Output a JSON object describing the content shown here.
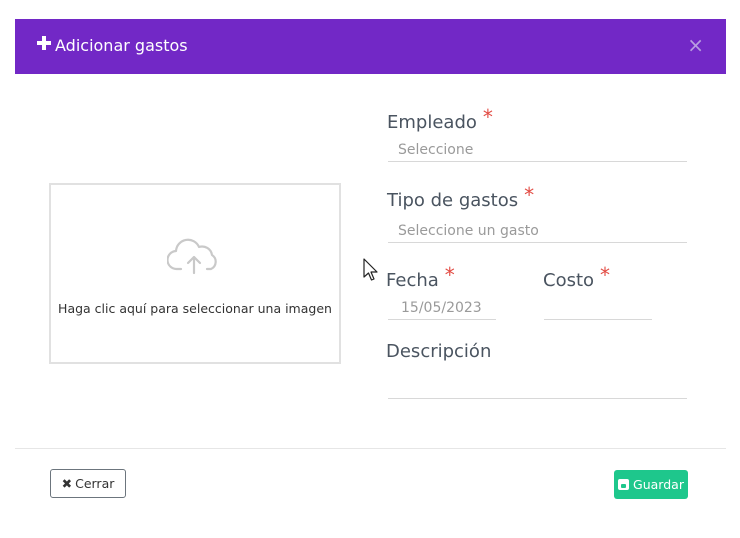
{
  "modal": {
    "title": "Adicionar gastos",
    "close_icon": "×"
  },
  "upload": {
    "hint": "Haga clic aquí para seleccionar una imagen",
    "icon": "cloud-upload-icon"
  },
  "fields": {
    "empleado": {
      "label": "Empleado",
      "placeholder": "Seleccione"
    },
    "tipo": {
      "label": "Tipo de gastos",
      "placeholder": "Seleccione un gasto"
    },
    "fecha": {
      "label": "Fecha",
      "placeholder": "15/05/2023"
    },
    "costo": {
      "label": "Costo",
      "value": ""
    },
    "descripcion": {
      "label": "Descripción",
      "value": ""
    },
    "required_mark": "*"
  },
  "footer": {
    "close_label": "Cerrar",
    "close_icon": "✖",
    "save_label": "Guardar"
  },
  "colors": {
    "header": "#7228c6",
    "save": "#1ec78c",
    "required": "#e24b43"
  }
}
